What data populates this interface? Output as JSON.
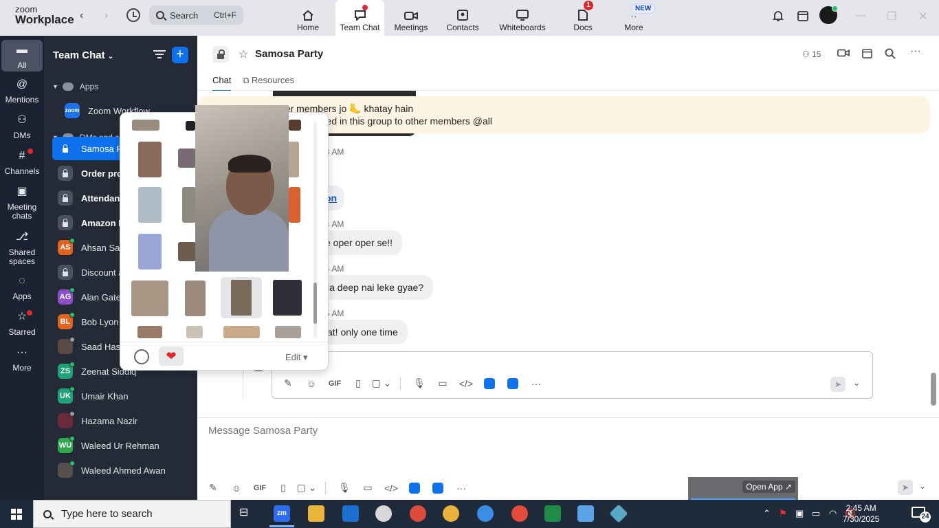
{
  "app": {
    "logo_line1": "zoom",
    "logo_line2": "Workplace"
  },
  "topbar": {
    "back": "‹",
    "forward": "›",
    "search": {
      "label": "Search",
      "shortcut": "Ctrl+F"
    },
    "tabs": [
      {
        "label": "Home",
        "icon": "home-icon"
      },
      {
        "label": "Team Chat",
        "icon": "chat-icon"
      },
      {
        "label": "Meetings",
        "icon": "video-icon"
      },
      {
        "label": "Contacts",
        "icon": "contacts-icon"
      },
      {
        "label": "Whiteboards",
        "icon": "whiteboard-icon"
      },
      {
        "label": "Docs",
        "icon": "docs-icon",
        "badge": "1"
      },
      {
        "label": "More",
        "icon": "more-icon",
        "badge": "NEW"
      }
    ]
  },
  "rail": [
    {
      "label": "All",
      "icon": "chat-bubble-icon"
    },
    {
      "label": "Mentions",
      "icon": "at-icon"
    },
    {
      "label": "DMs",
      "icon": "people-icon"
    },
    {
      "label": "Channels",
      "icon": "hash-icon"
    },
    {
      "label": "Meeting chats",
      "icon": "calendar-icon"
    },
    {
      "label": "Shared spaces",
      "icon": "share-icon"
    },
    {
      "label": "Apps",
      "icon": "apps-icon"
    },
    {
      "label": "Starred",
      "icon": "star-icon"
    },
    {
      "label": "More",
      "icon": "ellipsis-icon"
    }
  ],
  "sidebar": {
    "title": "Team Chat",
    "section_apps": "Apps",
    "app_item": "Zoom Workflow",
    "section_dms": "DMs and ch",
    "items": [
      {
        "label": "Samosa P",
        "type": "lock",
        "active": true
      },
      {
        "label": "Order pro",
        "type": "lock",
        "bold": true
      },
      {
        "label": "Attendan",
        "type": "lock",
        "bold": true
      },
      {
        "label": "Amazon E",
        "type": "lock",
        "bold": true
      },
      {
        "label": "Ahsan Sa",
        "initials": "AS",
        "color": "#e0641e"
      },
      {
        "label": "Discount a",
        "type": "lock"
      },
      {
        "label": "Alan Gate",
        "initials": "AG",
        "color": "#8a4fc9"
      },
      {
        "label": "Bob Lyon",
        "initials": "BL",
        "color": "#e0641e"
      },
      {
        "label": "Saad Has",
        "initials": "",
        "color": "#5b4b46"
      },
      {
        "label": "Zeenat Siddiq",
        "initials": "ZS",
        "color": "#1fa37a"
      },
      {
        "label": "Umair Khan",
        "initials": "UK",
        "color": "#1fa37a"
      },
      {
        "label": "Hazama Nazir",
        "initials": "",
        "color": "#6a2a3a"
      },
      {
        "label": "Waleed Ur Rehman",
        "initials": "WU",
        "color": "#2fa84f"
      },
      {
        "label": "Waleed Ahmed Awan",
        "initials": "",
        "color": "#55504a"
      }
    ]
  },
  "channel": {
    "title": "Samosa Party",
    "members": "15",
    "tabs": [
      "Chat",
      "Resources"
    ]
  },
  "chat": {
    "pinned_line1": "disrespecting other members jo 🦶 khatay hain",
    "pinned_line2": "ny picture and vdo shared in this group to other members @all",
    "messages": [
      {
        "time": "3 AM",
        "text": ""
      },
      {
        "time": "",
        "text": "on",
        "link": true
      },
      {
        "time": "4 AM",
        "text": "e oper oper se!!"
      },
      {
        "time": "4 AM",
        "text": "la deep nai leke gyae?"
      },
      {
        "time": "5 AM",
        "text": "at! only one time"
      }
    ]
  },
  "composer": {
    "placeholder": "Message Samosa Party",
    "open_app": "Open App ↗"
  },
  "popup": {
    "edit_label": "Edit ▾",
    "heart": "❤"
  },
  "taskbar": {
    "search_placeholder": "Type here to search",
    "time": "2:45 AM",
    "date": "7/30/2025",
    "notifications": "24"
  }
}
